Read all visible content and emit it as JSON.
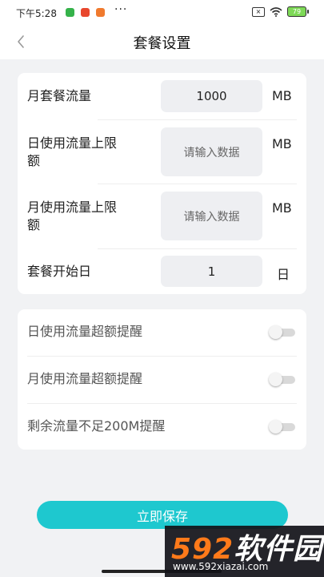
{
  "status_bar": {
    "time": "下午5:28",
    "more": "···",
    "battery": "79"
  },
  "header": {
    "title": "套餐设置"
  },
  "plan_settings": {
    "monthly_data": {
      "label": "月套餐流量",
      "value": "1000",
      "unit": "MB"
    },
    "daily_limit": {
      "label_line1": "日使用流量上限",
      "label_line2": "额",
      "placeholder": "请输入数据",
      "unit": "MB"
    },
    "monthly_limit": {
      "label_line1": "月使用流量上限",
      "label_line2": "额",
      "placeholder": "请输入数据",
      "unit": "MB"
    },
    "start_day": {
      "label": "套餐开始日",
      "value": "1",
      "unit": "日"
    }
  },
  "reminders": [
    {
      "label": "日使用流量超额提醒",
      "enabled": false
    },
    {
      "label": "月使用流量超额提醒",
      "enabled": false
    },
    {
      "label": "剩余流量不足200M提醒",
      "enabled": false
    }
  ],
  "save_button": {
    "label": "立即保存"
  },
  "watermark": {
    "number": "592",
    "text": "软件园",
    "url": "www.592xiazai.com"
  },
  "colors": {
    "accent": "#1ec8cf",
    "background": "#f1f2f4",
    "card": "#ffffff"
  }
}
